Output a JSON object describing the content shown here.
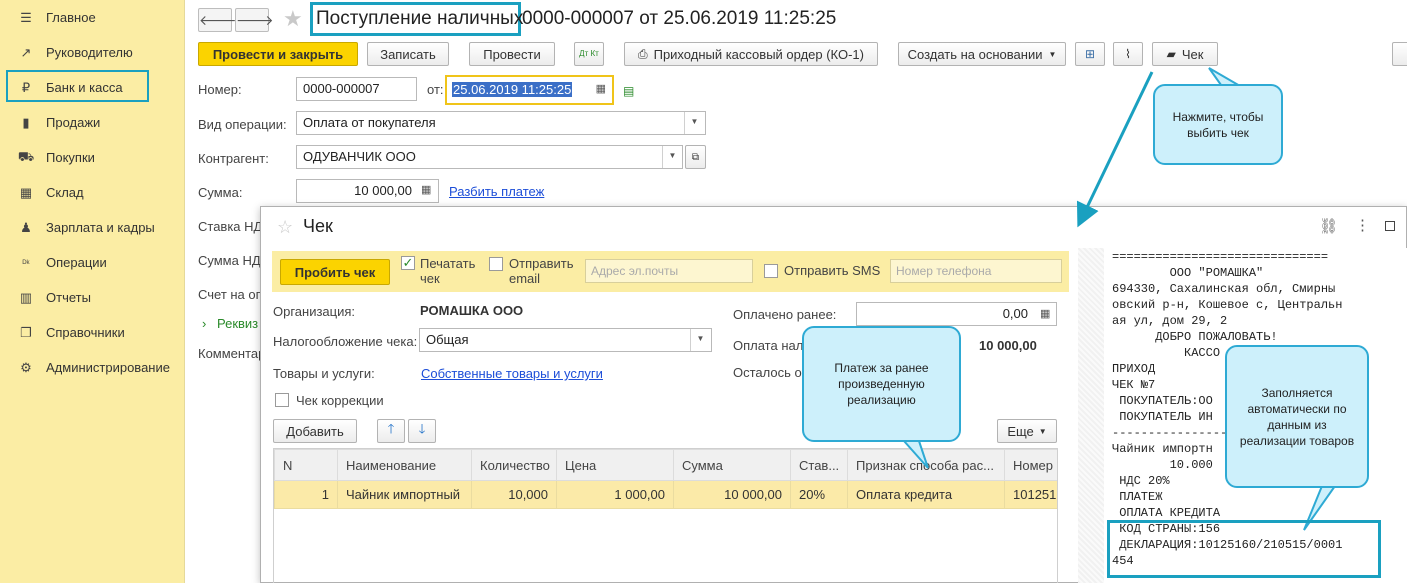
{
  "sidebar": {
    "items": [
      {
        "label": "Главное",
        "icon": "menu-icon",
        "glyph": "☰"
      },
      {
        "label": "Руководителю",
        "icon": "trend-icon",
        "glyph": "↗"
      },
      {
        "label": "Банк и касса",
        "icon": "ruble-icon",
        "glyph": "₽"
      },
      {
        "label": "Продажи",
        "icon": "bag-icon",
        "glyph": "▮"
      },
      {
        "label": "Покупки",
        "icon": "cart-icon",
        "glyph": "⛟"
      },
      {
        "label": "Склад",
        "icon": "grid-icon",
        "glyph": "▦"
      },
      {
        "label": "Зарплата и кадры",
        "icon": "person-icon",
        "glyph": "♟"
      },
      {
        "label": "Операции",
        "icon": "dt-kt-icon",
        "glyph": "ᴰᵏ"
      },
      {
        "label": "Отчеты",
        "icon": "bar-chart-icon",
        "glyph": "▥"
      },
      {
        "label": "Справочники",
        "icon": "book-icon",
        "glyph": "❐"
      },
      {
        "label": "Администрирование",
        "icon": "gear-icon",
        "glyph": "⚙"
      }
    ]
  },
  "form": {
    "title": "Поступление наличных",
    "title_rest": "0000-000007 от 25.06.2019 11:25:25",
    "toolbar": {
      "post_close": "Провести и закрыть",
      "save": "Записать",
      "post": "Провести",
      "dtkt": "Дт Кт",
      "ko1": "Приходный кассовый ордер (КО-1)",
      "create_based": "Создать на основании",
      "check": "Чек"
    },
    "number_label": "Номер:",
    "number_value": "0000-000007",
    "date_label": "от:",
    "date_value": "25.06.2019 11:25:25",
    "operation_label": "Вид операции:",
    "operation_value": "Оплата от покупателя",
    "counterparty_label": "Контрагент:",
    "counterparty_value": "ОДУВАНЧИК ООО",
    "amount_label": "Сумма:",
    "amount_value": "10 000,00",
    "split_link": "Разбить платеж",
    "vat_rate_label": "Ставка НД",
    "vat_sum_label": "Сумма НД",
    "account_label": "Счет на оп",
    "requisites_label": "Реквиз",
    "comment_label": "Комментар"
  },
  "callouts": {
    "check_hint": "Нажмите, чтобы выбить чек",
    "prior_payment": "Платеж за ранее произведенную реализацию",
    "auto_fill": "Заполняется автоматически по данным из реализации товаров"
  },
  "dialog": {
    "title": "Чек",
    "punch_button": "Пробить чек",
    "print_check": "Печатать чек",
    "send_email": "Отправить email",
    "email_placeholder": "Адрес эл.почты",
    "send_sms": "Отправить SMS",
    "phone_placeholder": "Номер телефона",
    "org_label": "Организация:",
    "org_value": "РОМАШКА ООО",
    "tax_label": "Налогообложение чека:",
    "tax_value": "Общая",
    "goods_label": "Товары и услуги:",
    "goods_link": "Собственные товары и услуги",
    "correction_label": "Чек коррекции",
    "paid_before_label": "Оплачено ранее:",
    "paid_before_value": "0,00",
    "payment_label": "Оплата нал",
    "payment_value": "10 000,00",
    "remaining_label": "Осталось о",
    "add_button": "Добавить",
    "more_button": "Еще",
    "table": {
      "headers": [
        "N",
        "Наименование",
        "Количество",
        "Цена",
        "Сумма",
        "Став...",
        "Признак способа рас...",
        "Номер"
      ],
      "rows": [
        [
          "1",
          "Чайник импортный",
          "10,000",
          "1 000,00",
          "10 000,00",
          "20%",
          "Оплата кредита",
          "101251"
        ]
      ]
    }
  },
  "receipt": {
    "lines": [
      "==============================",
      "        ООО \"РОМАШКА\"",
      "694330, Сахалинская обл, Смирны",
      "овский р-н, Кошевое с, Центральн",
      "ая ул, дом 29, 2",
      "      ДОБРО ПОЖАЛОВАТЬ!",
      "          КАССО",
      "ПРИХОД",
      "ЧЕК №7",
      " ПОКУПАТЕЛЬ:ОО",
      " ПОКУПАТЕЛЬ ИН",
      "------------------",
      "Чайник импортн",
      "        10.000",
      " НДС 20%",
      " ПЛАТЕЖ",
      " ОПЛАТА КРЕДИТА",
      " КОД СТРАНЫ:156",
      " ДЕКЛАРАЦИЯ:10125160/210515/0001",
      "454",
      "------------------------------"
    ]
  }
}
